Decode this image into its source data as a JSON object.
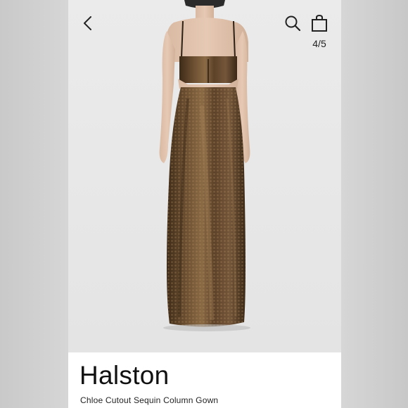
{
  "header": {
    "back_icon": "chevron-left-icon",
    "search_icon": "search-icon",
    "bag_icon": "shopping-bag-icon",
    "image_counter": "4/5"
  },
  "product": {
    "brand": "Halston",
    "name": "Chloe Cutout Sequin Column Gown",
    "image_alt": "back view of bronze sequin column gown with cutouts"
  },
  "colors": {
    "background": "#ebebeb",
    "gown": "#5a4126",
    "text": "#111111"
  }
}
